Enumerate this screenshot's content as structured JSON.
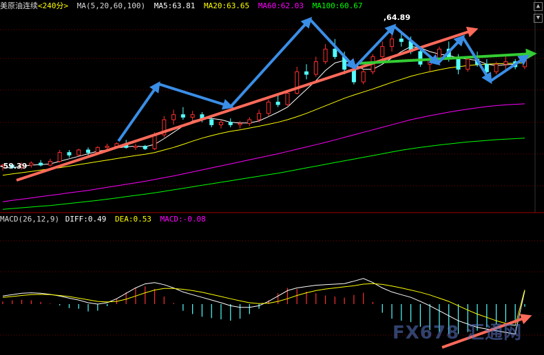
{
  "header": {
    "symbol": "美原油连续",
    "period": "<240分>",
    "ma_label": "MA(5,20,60,100)",
    "ma5": "MA5:63.81",
    "ma20": "MA20:63.65",
    "ma60": "MA60:62.03",
    "ma100": "MA100:60.67"
  },
  "macd_header": {
    "label": "MACD(26,12,9)",
    "diff": "DIFF:0.49",
    "dea": "DEA:0.53",
    "macd": "MACD:-0.08"
  },
  "annotations": {
    "high": "64.89",
    "low": "59.39"
  },
  "watermark": "FX678 汇通网",
  "colors": {
    "background": "#000000",
    "up": "#ff3030",
    "down": "#54ffff",
    "ma5": "#ffffff",
    "ma20": "#ffff00",
    "ma60": "#ff00ff",
    "ma100": "#00ff00",
    "trend_red": "#ff6a5a",
    "trend_green": "#33cc33",
    "arrows_blue": "#3a8ee6",
    "grid": "#800000"
  },
  "chart_data": {
    "type": "candlestick",
    "y_range": [
      57.8,
      65.6
    ],
    "price_candles": [
      [
        59.55,
        59.65,
        59.39,
        59.6
      ],
      [
        59.6,
        59.62,
        59.45,
        59.5
      ],
      [
        59.5,
        59.7,
        59.42,
        59.6
      ],
      [
        59.6,
        59.75,
        59.5,
        59.68
      ],
      [
        59.68,
        59.8,
        59.55,
        59.6
      ],
      [
        59.6,
        59.85,
        59.55,
        59.75
      ],
      [
        59.75,
        60.2,
        59.7,
        60.1
      ],
      [
        60.1,
        60.2,
        59.9,
        60.0
      ],
      [
        60.0,
        60.25,
        59.95,
        60.2
      ],
      [
        60.2,
        60.3,
        60.0,
        60.1
      ],
      [
        60.1,
        60.35,
        60.05,
        60.3
      ],
      [
        60.3,
        60.45,
        60.2,
        60.35
      ],
      [
        60.35,
        60.5,
        60.3,
        60.45
      ],
      [
        60.45,
        60.6,
        60.25,
        60.3
      ],
      [
        60.3,
        60.45,
        60.2,
        60.35
      ],
      [
        60.35,
        60.4,
        60.2,
        60.25
      ],
      [
        60.25,
        60.9,
        60.2,
        60.8
      ],
      [
        60.8,
        61.55,
        60.7,
        61.4
      ],
      [
        61.4,
        61.8,
        61.2,
        61.6
      ],
      [
        61.6,
        61.9,
        61.4,
        61.5
      ],
      [
        61.5,
        61.75,
        61.35,
        61.6
      ],
      [
        61.6,
        61.7,
        61.3,
        61.4
      ],
      [
        61.4,
        61.55,
        61.1,
        61.2
      ],
      [
        61.2,
        61.4,
        61.05,
        61.3
      ],
      [
        61.3,
        61.45,
        61.1,
        61.2
      ],
      [
        61.2,
        61.35,
        61.05,
        61.25
      ],
      [
        61.25,
        61.5,
        61.15,
        61.4
      ],
      [
        61.4,
        61.8,
        61.3,
        61.65
      ],
      [
        61.65,
        62.2,
        61.55,
        62.1
      ],
      [
        62.1,
        62.4,
        61.9,
        62.0
      ],
      [
        62.0,
        62.5,
        61.95,
        62.45
      ],
      [
        62.45,
        63.5,
        62.4,
        63.3
      ],
      [
        63.3,
        63.6,
        63.0,
        63.2
      ],
      [
        63.2,
        63.9,
        63.1,
        63.7
      ],
      [
        63.7,
        64.4,
        63.6,
        64.2
      ],
      [
        64.2,
        64.6,
        63.8,
        63.9
      ],
      [
        63.9,
        64.1,
        63.2,
        63.4
      ],
      [
        63.4,
        63.5,
        62.8,
        62.9
      ],
      [
        62.9,
        63.4,
        62.8,
        63.3
      ],
      [
        63.3,
        64.0,
        63.2,
        63.9
      ],
      [
        63.9,
        64.5,
        63.7,
        64.3
      ],
      [
        64.3,
        64.8,
        64.1,
        64.6
      ],
      [
        64.6,
        64.89,
        64.3,
        64.5
      ],
      [
        64.5,
        64.7,
        64.0,
        64.1
      ],
      [
        64.1,
        64.3,
        63.5,
        63.6
      ],
      [
        63.6,
        63.9,
        63.3,
        63.8
      ],
      [
        63.8,
        64.3,
        63.6,
        64.2
      ],
      [
        64.2,
        64.5,
        63.7,
        63.8
      ],
      [
        63.8,
        64.0,
        63.2,
        63.4
      ],
      [
        63.4,
        63.9,
        63.3,
        63.8
      ],
      [
        63.8,
        64.1,
        63.5,
        63.6
      ],
      [
        63.6,
        63.8,
        63.1,
        63.3
      ],
      [
        63.3,
        63.7,
        63.2,
        63.6
      ],
      [
        63.6,
        63.9,
        63.4,
        63.7
      ],
      [
        63.7,
        63.8,
        63.4,
        63.5
      ],
      [
        63.5,
        63.9,
        63.4,
        63.81
      ]
    ],
    "ma_series": [
      {
        "name": "MA5",
        "values": [
          59.5,
          59.5,
          59.55,
          59.6,
          59.62,
          59.65,
          59.75,
          59.85,
          59.95,
          60.05,
          60.15,
          60.2,
          60.28,
          60.33,
          60.35,
          60.33,
          60.42,
          60.65,
          60.9,
          61.15,
          61.35,
          61.45,
          61.45,
          61.4,
          61.3,
          61.27,
          61.27,
          61.35,
          61.52,
          61.7,
          61.9,
          62.25,
          62.6,
          62.95,
          63.35,
          63.65,
          63.75,
          63.6,
          63.4,
          63.4,
          63.6,
          63.85,
          64.1,
          64.3,
          64.25,
          64.1,
          64.0,
          63.95,
          63.85,
          63.8,
          63.75,
          63.6,
          63.55,
          63.58,
          63.6,
          63.81
        ]
      },
      {
        "name": "MA20",
        "values": [
          59.2,
          59.25,
          59.3,
          59.35,
          59.4,
          59.45,
          59.5,
          59.56,
          59.62,
          59.68,
          59.74,
          59.8,
          59.86,
          59.92,
          59.98,
          60.03,
          60.1,
          60.2,
          60.3,
          60.42,
          60.55,
          60.67,
          60.77,
          60.86,
          60.94,
          61.0,
          61.07,
          61.14,
          61.22,
          61.3,
          61.4,
          61.52,
          61.65,
          61.8,
          61.95,
          62.1,
          62.25,
          62.38,
          62.5,
          62.62,
          62.75,
          62.88,
          63.0,
          63.12,
          63.22,
          63.3,
          63.38,
          63.45,
          63.5,
          63.55,
          63.58,
          63.6,
          63.62,
          63.63,
          63.64,
          63.65
        ]
      },
      {
        "name": "MA60",
        "values": [
          58.15,
          58.2,
          58.25,
          58.3,
          58.35,
          58.4,
          58.45,
          58.5,
          58.55,
          58.6,
          58.66,
          58.72,
          58.78,
          58.84,
          58.9,
          58.96,
          59.03,
          59.1,
          59.17,
          59.25,
          59.33,
          59.41,
          59.49,
          59.57,
          59.65,
          59.73,
          59.81,
          59.89,
          59.97,
          60.05,
          60.14,
          60.23,
          60.32,
          60.41,
          60.5,
          60.6,
          60.7,
          60.8,
          60.9,
          61.0,
          61.1,
          61.2,
          61.3,
          61.4,
          61.48,
          61.56,
          61.63,
          61.7,
          61.76,
          61.82,
          61.87,
          61.92,
          61.96,
          61.99,
          62.01,
          62.03
        ]
      },
      {
        "name": "MA100",
        "values": [
          57.85,
          57.88,
          57.91,
          57.94,
          57.97,
          58.0,
          58.04,
          58.08,
          58.12,
          58.16,
          58.2,
          58.25,
          58.3,
          58.35,
          58.4,
          58.45,
          58.5,
          58.56,
          58.62,
          58.68,
          58.74,
          58.8,
          58.86,
          58.92,
          58.98,
          59.04,
          59.1,
          59.16,
          59.22,
          59.28,
          59.35,
          59.42,
          59.49,
          59.56,
          59.63,
          59.7,
          59.77,
          59.84,
          59.91,
          59.98,
          60.05,
          60.12,
          60.19,
          60.25,
          60.3,
          60.35,
          60.4,
          60.44,
          60.48,
          60.52,
          60.55,
          60.58,
          60.61,
          60.63,
          60.65,
          60.67
        ]
      }
    ],
    "macd_range": [
      -1.2,
      1.2
    ],
    "diff": [
      0.3,
      0.35,
      0.4,
      0.42,
      0.4,
      0.36,
      0.3,
      0.22,
      0.15,
      0.05,
      0.0,
      0.05,
      0.2,
      0.4,
      0.6,
      0.75,
      0.8,
      0.72,
      0.6,
      0.45,
      0.35,
      0.25,
      0.15,
      0.05,
      -0.05,
      -0.1,
      -0.1,
      -0.05,
      0.1,
      0.3,
      0.5,
      0.6,
      0.65,
      0.7,
      0.72,
      0.74,
      0.76,
      0.85,
      0.95,
      0.8,
      0.6,
      0.45,
      0.35,
      0.25,
      0.1,
      -0.05,
      -0.2,
      -0.35,
      -0.5,
      -0.6,
      -0.7,
      -0.75,
      -0.8,
      -0.85,
      -0.9,
      0.49
    ],
    "dea": [
      0.25,
      0.28,
      0.32,
      0.35,
      0.36,
      0.35,
      0.32,
      0.28,
      0.22,
      0.16,
      0.1,
      0.08,
      0.1,
      0.18,
      0.3,
      0.42,
      0.52,
      0.58,
      0.58,
      0.55,
      0.5,
      0.44,
      0.36,
      0.28,
      0.2,
      0.12,
      0.05,
      0.02,
      0.03,
      0.1,
      0.2,
      0.32,
      0.42,
      0.5,
      0.56,
      0.6,
      0.64,
      0.68,
      0.74,
      0.76,
      0.73,
      0.67,
      0.6,
      0.52,
      0.44,
      0.34,
      0.22,
      0.1,
      -0.05,
      -0.18,
      -0.3,
      -0.4,
      -0.5,
      -0.58,
      -0.65,
      0.53
    ],
    "macd_hist": [
      0.1,
      0.14,
      0.16,
      0.14,
      0.08,
      0.02,
      -0.04,
      -0.12,
      -0.14,
      -0.22,
      -0.2,
      -0.06,
      0.2,
      0.44,
      0.6,
      0.66,
      0.56,
      0.28,
      0.04,
      -0.2,
      -0.3,
      -0.38,
      -0.42,
      -0.46,
      -0.5,
      -0.44,
      -0.3,
      -0.14,
      0.14,
      0.4,
      0.6,
      0.56,
      0.46,
      0.4,
      0.32,
      0.28,
      0.24,
      0.34,
      0.42,
      0.08,
      -0.26,
      -0.44,
      -0.5,
      -0.54,
      -0.68,
      -0.78,
      -0.84,
      -0.9,
      -0.9,
      -0.84,
      -0.8,
      -0.7,
      -0.6,
      -0.54,
      -0.5,
      -0.08
    ]
  }
}
